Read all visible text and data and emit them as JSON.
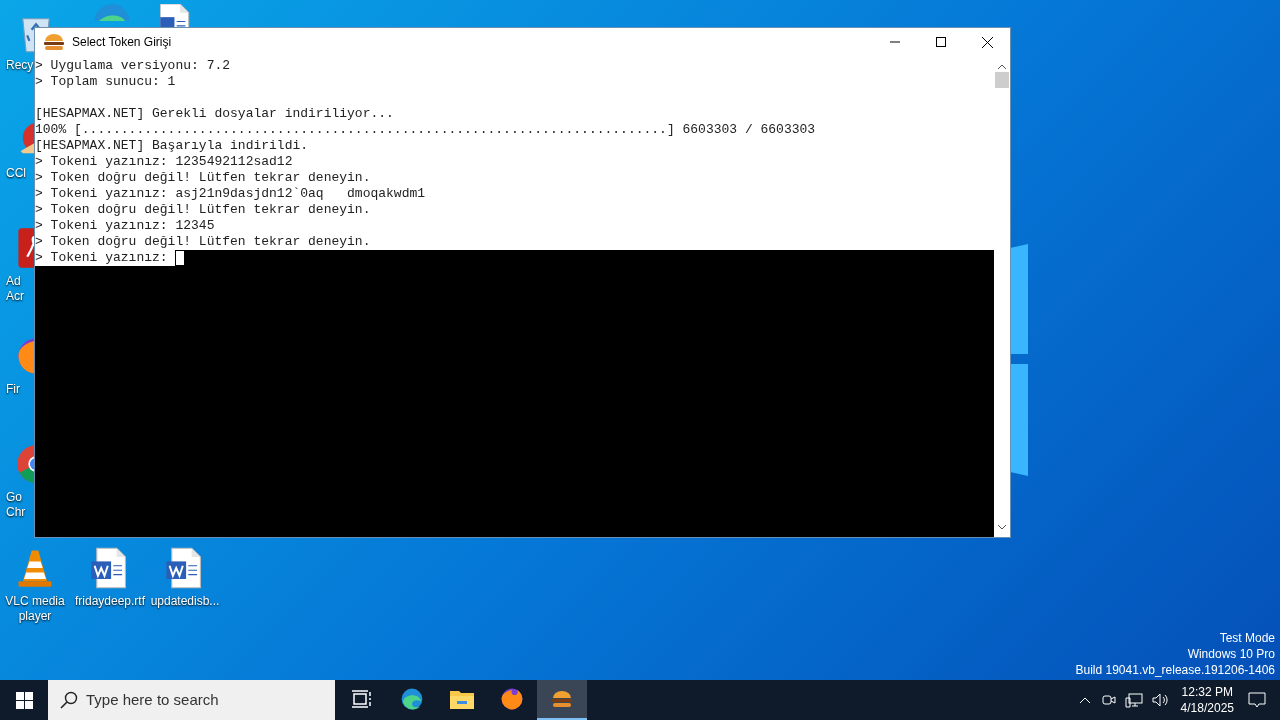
{
  "desktop_icons_left": [
    {
      "label": "Recy",
      "kind": "bin"
    },
    {
      "label": "CCl",
      "kind": "ccleaner"
    },
    {
      "label": "Ad Acr",
      "kind": "acrobat"
    },
    {
      "label": "Fir",
      "kind": "firefox"
    },
    {
      "label": "Go Chr",
      "kind": "chrome"
    }
  ],
  "desktop_icons_top": [
    {
      "kind": "edge"
    },
    {
      "kind": "word"
    }
  ],
  "desktop_icons_bottom": [
    {
      "label": "VLC media player",
      "kind": "vlc"
    },
    {
      "label": "fridaydeep.rtf",
      "kind": "word"
    },
    {
      "label": "updatedisb...",
      "kind": "word"
    }
  ],
  "window": {
    "title": "Select Token Girişi",
    "lines": [
      {
        "text": "> Uygulama versiyonu: 7.2",
        "kind": "line"
      },
      {
        "text": "> Toplam sunucu: 1",
        "kind": "line"
      },
      {
        "kind": "blank"
      },
      {
        "text": "[HESAPMAX.NET] Gerekli dosyalar indiriliyor...",
        "kind": "line"
      },
      {
        "text": "100% [...........................................................................] 6603303 / 6603303",
        "kind": "line"
      },
      {
        "text": "[HESAPMAX.NET] Başarıyla indirildi.",
        "kind": "line"
      },
      {
        "text": "> Tokeni yazınız: 1235492112sad12",
        "kind": "line"
      },
      {
        "text": "> Token doğru değil! Lütfen tekrar deneyin.",
        "kind": "line"
      },
      {
        "text": "> Tokeni yazınız: asj21n9dasjdn12`0aq   dmoqakwdm1",
        "kind": "line"
      },
      {
        "text": "> Token doğru değil! Lütfen tekrar deneyin.",
        "kind": "line"
      },
      {
        "text": "> Tokeni yazınız: 12345",
        "kind": "line"
      },
      {
        "text": "> Token doğru değil! Lütfen tekrar deneyin.",
        "kind": "line"
      },
      {
        "text": "> Tokeni yazınız: ",
        "kind": "prompt"
      }
    ]
  },
  "os_info": [
    "Test Mode",
    "Windows 10 Pro",
    "Build 19041.vb_release.191206-1406"
  ],
  "taskbar": {
    "search_placeholder": "Type here to search",
    "apps": [
      {
        "kind": "taskview",
        "selected": false
      },
      {
        "kind": "edge",
        "selected": false
      },
      {
        "kind": "explorer",
        "selected": false
      },
      {
        "kind": "firefox",
        "selected": false
      },
      {
        "kind": "burger",
        "selected": true
      }
    ],
    "time": "12:32 PM",
    "date": "4/18/2025"
  }
}
